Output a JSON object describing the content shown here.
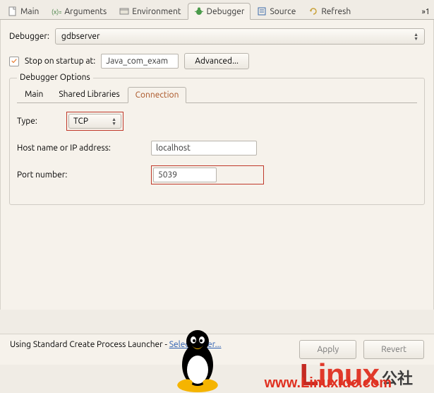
{
  "top_tabs": {
    "main": "Main",
    "arguments": "Arguments",
    "environment": "Environment",
    "debugger": "Debugger",
    "source": "Source",
    "refresh": "Refresh",
    "overflow": "»1"
  },
  "debugger_label": "Debugger:",
  "debugger_value": "gdbserver",
  "stop_checkbox_label": "Stop on startup at:",
  "stop_input_value": "Java_com_exam",
  "advanced_button": "Advanced...",
  "options_legend": "Debugger Options",
  "sub_tabs": {
    "main": "Main",
    "shared": "Shared Libraries",
    "connection": "Connection"
  },
  "type_label": "Type:",
  "type_value": "TCP",
  "host_label": "Host name or IP address:",
  "host_value": "localhost",
  "port_label": "Port number:",
  "port_value": "5039",
  "launcher_prefix": "Using Standard Create Process Launcher - ",
  "launcher_link": "Select other...",
  "apply_button": "Apply",
  "revert_button": "Revert",
  "watermark": {
    "brand": "Linux",
    "suffix": "公社",
    "url": "www.Linuxidc.com"
  }
}
